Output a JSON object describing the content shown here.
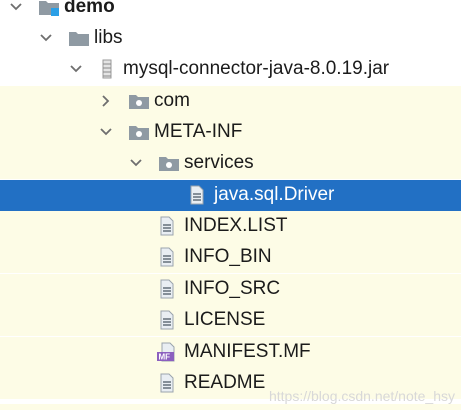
{
  "tree": {
    "project": "demo",
    "libs": "libs",
    "jar": "mysql-connector-java-8.0.19.jar",
    "com": "com",
    "meta_inf": "META-INF",
    "services": "services",
    "driver": "java.sql.Driver",
    "index_list": "INDEX.LIST",
    "info_bin": "INFO_BIN",
    "info_src": "INFO_SRC",
    "license": "LICENSE",
    "manifest": "MANIFEST.MF",
    "manifest_badge": "MF",
    "readme": "README"
  },
  "watermark": "https://blog.csdn.net/note_hsy",
  "colors": {
    "selection": "#2270c4",
    "highlight_bg": "#fdfce6",
    "folder": "#8f9aa3",
    "project_folder": "#2b9fe6"
  },
  "icons": {
    "expanded": "chevron-down-icon",
    "collapsed": "chevron-right-icon",
    "folder": "folder-icon",
    "package": "package-folder-icon",
    "jar": "jar-icon",
    "file": "text-file-icon",
    "manifest": "manifest-file-icon"
  }
}
